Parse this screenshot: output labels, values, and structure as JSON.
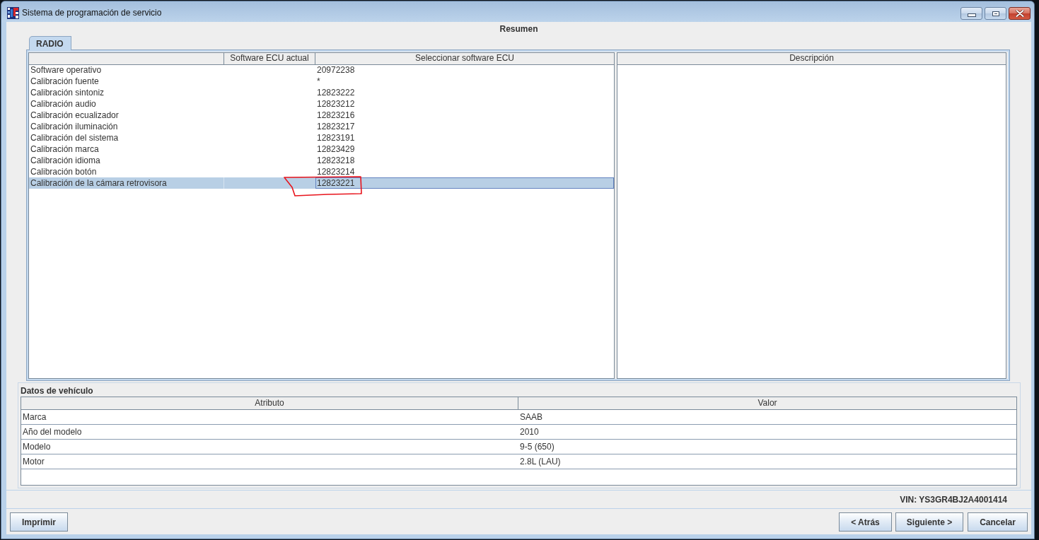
{
  "window": {
    "title": "Sistema de programación de servicio"
  },
  "heading": "Resumen",
  "tabs": [
    {
      "label": "RADIO",
      "selected": true
    }
  ],
  "ecu_table": {
    "columns": [
      "Software ECU actual",
      "Seleccionar software ECU"
    ],
    "rows": [
      {
        "item": "Software operativo",
        "selected_software": "20972238",
        "selected": false,
        "circled": false
      },
      {
        "item": "Calibración fuente",
        "selected_software": "*",
        "selected": false,
        "circled": false
      },
      {
        "item": "Calibración sintoniz",
        "selected_software": "12823222",
        "selected": false,
        "circled": false
      },
      {
        "item": "Calibración audio",
        "selected_software": "12823212",
        "selected": false,
        "circled": false
      },
      {
        "item": "Calibración ecualizador",
        "selected_software": "12823216",
        "selected": false,
        "circled": false
      },
      {
        "item": "Calibración iluminación",
        "selected_software": "12823217",
        "selected": false,
        "circled": false
      },
      {
        "item": "Calibración del sistema",
        "selected_software": "12823191",
        "selected": false,
        "circled": false
      },
      {
        "item": "Calibración marca",
        "selected_software": "12823429",
        "selected": false,
        "circled": false
      },
      {
        "item": "Calibración idioma",
        "selected_software": "12823218",
        "selected": false,
        "circled": false
      },
      {
        "item": "Calibración botón",
        "selected_software": "12823214",
        "selected": false,
        "circled": false
      },
      {
        "item": "Calibración de la cámara retrovisora",
        "selected_software": "12823221",
        "selected": true,
        "circled": true
      }
    ]
  },
  "description_table": {
    "columns": [
      "Descripción"
    ]
  },
  "vehicle_data": {
    "title": "Datos de vehículo",
    "columns": [
      "Atributo",
      "Valor"
    ],
    "rows": [
      {
        "attribute": "Marca",
        "value": "SAAB"
      },
      {
        "attribute": "Año del modelo",
        "value": "2010"
      },
      {
        "attribute": "Modelo",
        "value": "9-5 (650)"
      },
      {
        "attribute": "Motor",
        "value": "2.8L (LAU)"
      }
    ]
  },
  "vin": "VIN: YS3GR4BJ2A4001414",
  "left_buttons": [
    "Imprimir"
  ],
  "right_buttons": [
    "< Atrás",
    "Siguiente >",
    "Cancelar"
  ]
}
